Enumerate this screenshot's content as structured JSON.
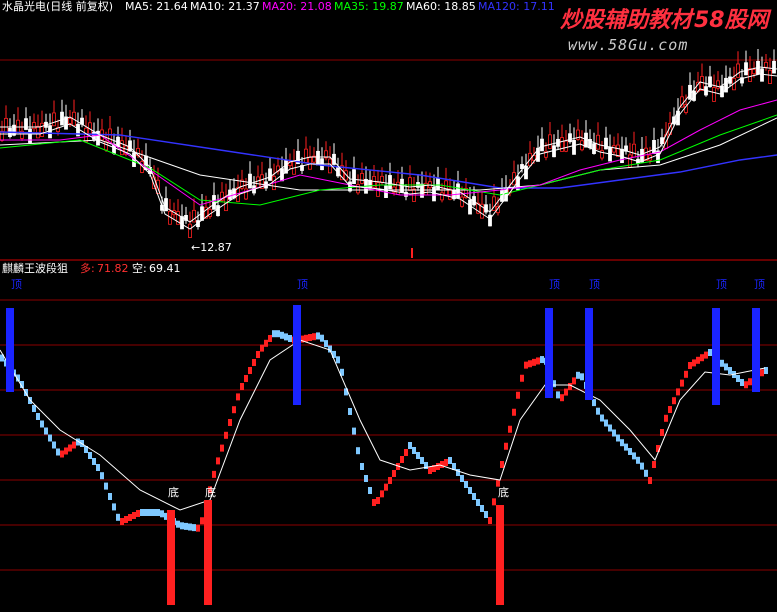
{
  "colors": {
    "background": "#000000",
    "grid": "#8b0000",
    "white": "#ffffff",
    "ma5": "#ffffff",
    "ma10": "#ffffff",
    "ma20": "#ff00ff",
    "ma35": "#00ff00",
    "ma60": "#ffffff",
    "ma120": "#3333ff",
    "red": "#ff2020",
    "lightblue": "#7ec8ff",
    "blue": "#1a24ff",
    "title_red": "#ff3030",
    "watermark_red": "#ff3040",
    "watermark_gray": "#c9c9c9"
  },
  "top_panel": {
    "title": "水晶光电(日线 前复权)",
    "ma_labels": [
      {
        "text": "MA5: 21.64",
        "color": "#ffffff"
      },
      {
        "text": "MA10: 21.37",
        "color": "#ffffff"
      },
      {
        "text": "MA20: 21.08",
        "color": "#ff00ff"
      },
      {
        "text": "MA35: 19.87",
        "color": "#00ff00"
      },
      {
        "text": "MA60: 18.85",
        "color": "#ffffff"
      },
      {
        "text": "MA120: 17.11",
        "color": "#3333ff"
      }
    ],
    "low_label": "←12.87"
  },
  "watermark": {
    "brand": "炒股辅助教材",
    "brand_suffix": "58股网",
    "url": "www.58Gu.com"
  },
  "bottom_panel": {
    "title": "麒麟王波段狙",
    "long_label": "多:",
    "long_value": "71.82",
    "short_label": "空:",
    "short_value": "69.41",
    "bottom_marker_label": "底",
    "top_marker_label": "顶"
  },
  "chart_data": [
    {
      "type": "line",
      "title": "水晶光电(日线 前复权)",
      "series": [
        {
          "name": "MA5",
          "value": 21.64
        },
        {
          "name": "MA10",
          "value": 21.37
        },
        {
          "name": "MA20",
          "value": 21.08
        },
        {
          "name": "MA35",
          "value": 19.87
        },
        {
          "name": "MA60",
          "value": 18.85
        },
        {
          "name": "MA120",
          "value": 17.11
        }
      ],
      "annotations": [
        "←12.87"
      ]
    },
    {
      "type": "bar",
      "title": "麒麟王波段狙",
      "series": [
        {
          "name": "多",
          "value": 71.82
        },
        {
          "name": "空",
          "value": 69.41
        }
      ],
      "markers": [
        "顶",
        "顶",
        "顶",
        "顶",
        "顶",
        "顶",
        "底",
        "底",
        "底"
      ]
    }
  ]
}
